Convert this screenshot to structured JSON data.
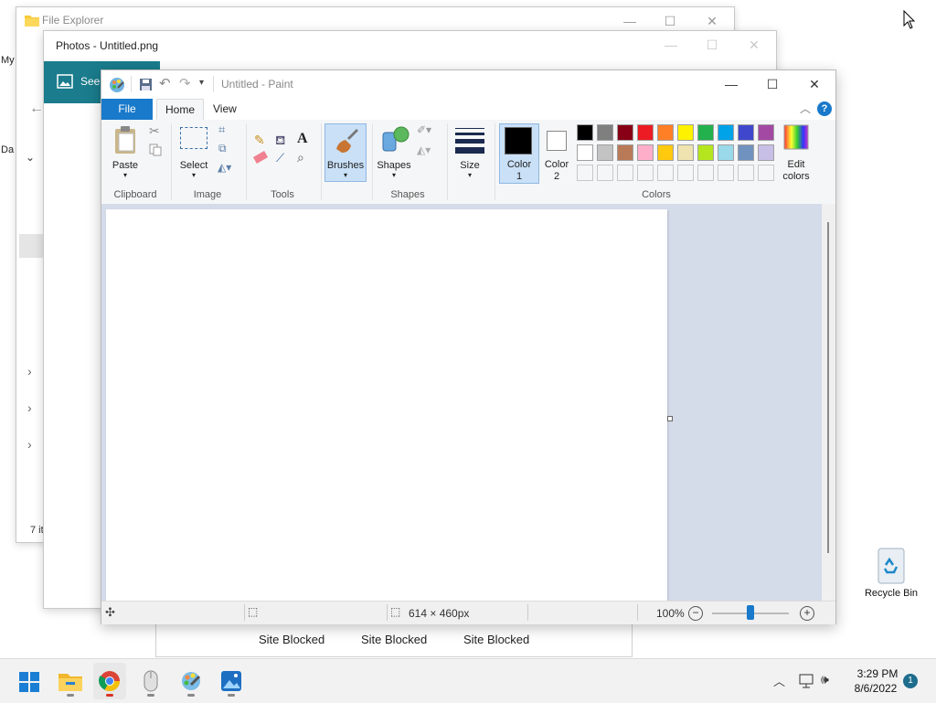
{
  "desktop": {
    "partial_labels": [
      "My",
      "Da"
    ],
    "recycle_bin_label": "Recycle Bin"
  },
  "file_explorer": {
    "title": "File Explorer",
    "item_count": "7 it",
    "controls": {
      "minimize": "—",
      "maximize": "☐",
      "close": "✕"
    }
  },
  "photos": {
    "title": "Photos - Untitled.png",
    "header_text": "See",
    "controls": {
      "minimize": "—",
      "maximize": "☐",
      "close": "✕"
    }
  },
  "paint": {
    "title": "Untitled - Paint",
    "controls": {
      "minimize": "—",
      "maximize": "☐",
      "close": "✕"
    },
    "tabs": {
      "file": "File",
      "home": "Home",
      "view": "View"
    },
    "groups": {
      "clipboard": {
        "label": "Clipboard",
        "paste": "Paste"
      },
      "image": {
        "label": "Image",
        "select": "Select"
      },
      "tools": {
        "label": "Tools"
      },
      "brushes": {
        "label": "Brushes"
      },
      "shapes": {
        "label": "Shapes",
        "button": "Shapes"
      },
      "size": {
        "label": "Size"
      },
      "colors": {
        "label": "Colors",
        "color1": "Color",
        "color1_num": "1",
        "color2": "Color",
        "color2_num": "2",
        "edit_colors": "Edit",
        "edit_colors2": "colors"
      }
    },
    "palette_row1": [
      "#000000",
      "#7f7f7f",
      "#880015",
      "#ed1c24",
      "#ff7f27",
      "#fff200",
      "#22b14c",
      "#00a2e8",
      "#3f48cc",
      "#a349a4"
    ],
    "palette_row2": [
      "#ffffff",
      "#c3c3c3",
      "#b97a57",
      "#ffaec9",
      "#ffc90e",
      "#efe4b0",
      "#b5e61d",
      "#99d9ea",
      "#7092be",
      "#c8bfe7"
    ],
    "color1_value": "#000000",
    "color2_value": "#ffffff",
    "status": {
      "canvas_size": "614 × 460px",
      "zoom": "100%"
    }
  },
  "blocked_tabs": [
    "Site Blocked",
    "Site Blocked",
    "Site Blocked"
  ],
  "taskbar": {
    "time": "3:29 PM",
    "date": "8/6/2022",
    "notifications": "1"
  }
}
